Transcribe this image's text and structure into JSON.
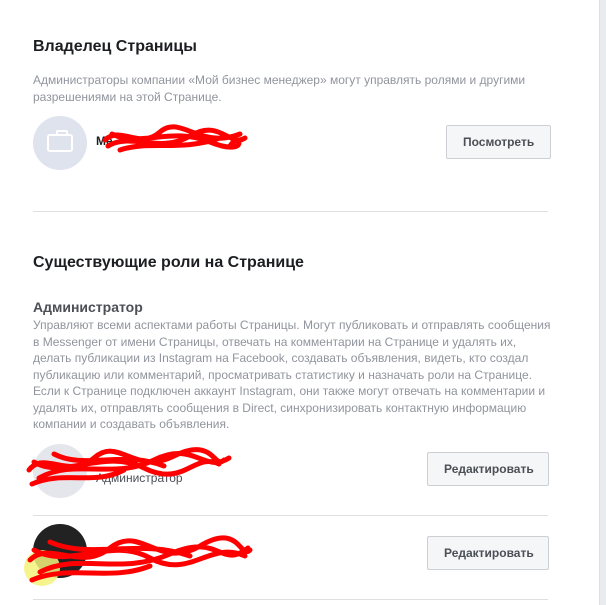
{
  "owner_section": {
    "title": "Владелец Страницы",
    "description": "Администраторы компании «Мой бизнес менеджер» могут управлять ролями и другими разрешениями на этой Странице.",
    "entity_name_visible": "Ме",
    "view_button": "Посмотреть"
  },
  "roles_section": {
    "title": "Существующие роли на Странице",
    "admin_role": {
      "title": "Администратор",
      "description": "Управляют всеми аспектами работы Страницы. Могут публиковать и отправлять сообщения в Messenger от имени Страницы, отвечать на комментарии на Странице и удалять их, делать публикации из Instagram на Facebook, создавать объявления, видеть, кто создал публикацию или комментарий, просматривать статистику и назначать роли на Странице. Если к Странице подключен аккаунт Instagram, они также могут отвечать на комментарии и удалять их, отправлять сообщения в Direct, синхронизировать контактную информацию компании и создавать объявления."
    },
    "people": [
      {
        "role": "Администратор",
        "edit_button": "Редактировать"
      },
      {
        "edit_button": "Редактировать"
      }
    ]
  },
  "colors": {
    "redaction": "#ff0000",
    "button_bg": "#f5f6f7",
    "divider": "#dddfe2",
    "muted_text": "#90949c"
  },
  "icons": {
    "owner_avatar": "briefcase-icon"
  }
}
